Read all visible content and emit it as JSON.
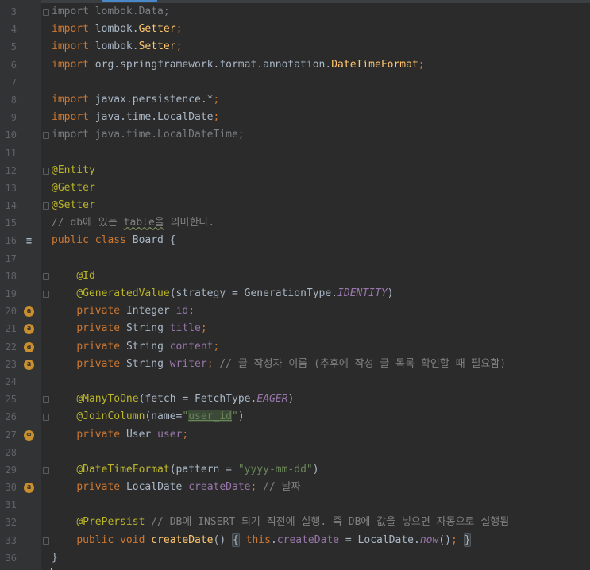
{
  "editor": {
    "lines": [
      {
        "n": "3",
        "t": [
          {
            "c": "dim",
            "s": "import lombok.Data;"
          }
        ],
        "fold": true
      },
      {
        "n": "4",
        "t": [
          {
            "c": "kw",
            "s": "import "
          },
          {
            "c": "",
            "s": "lombok."
          },
          {
            "c": "fn",
            "s": "Getter"
          },
          {
            "c": "kw",
            "s": ";"
          }
        ]
      },
      {
        "n": "5",
        "t": [
          {
            "c": "kw",
            "s": "import "
          },
          {
            "c": "",
            "s": "lombok."
          },
          {
            "c": "fn",
            "s": "Setter"
          },
          {
            "c": "kw",
            "s": ";"
          }
        ]
      },
      {
        "n": "6",
        "t": [
          {
            "c": "kw",
            "s": "import "
          },
          {
            "c": "",
            "s": "org.springframework.format.annotation."
          },
          {
            "c": "fn",
            "s": "DateTimeFormat"
          },
          {
            "c": "kw",
            "s": ";"
          }
        ]
      },
      {
        "n": "7",
        "t": []
      },
      {
        "n": "8",
        "t": [
          {
            "c": "kw",
            "s": "import "
          },
          {
            "c": "",
            "s": "javax.persistence.*"
          },
          {
            "c": "kw",
            "s": ";"
          }
        ]
      },
      {
        "n": "9",
        "t": [
          {
            "c": "kw",
            "s": "import "
          },
          {
            "c": "",
            "s": "java.time.LocalDate"
          },
          {
            "c": "kw",
            "s": ";"
          }
        ]
      },
      {
        "n": "10",
        "t": [
          {
            "c": "dim",
            "s": "import java.time.LocalDateTime;"
          }
        ],
        "fold": true
      },
      {
        "n": "11",
        "t": []
      },
      {
        "n": "12",
        "t": [
          {
            "c": "ann",
            "s": "@Entity"
          }
        ],
        "fold": true
      },
      {
        "n": "13",
        "t": [
          {
            "c": "ann",
            "s": "@Getter"
          }
        ]
      },
      {
        "n": "14",
        "t": [
          {
            "c": "ann",
            "s": "@Setter"
          }
        ],
        "fold": true
      },
      {
        "n": "15",
        "t": [
          {
            "c": "cmt",
            "s": "// db에 있는 "
          },
          {
            "c": "cmt sq",
            "s": "table을"
          },
          {
            "c": "cmt",
            "s": " 의미한다."
          }
        ]
      },
      {
        "n": "16",
        "t": [
          {
            "c": "kw",
            "s": "public class "
          },
          {
            "c": "",
            "s": "Board {"
          }
        ],
        "icon": "≡",
        "iconClass": "db"
      },
      {
        "n": "17",
        "t": []
      },
      {
        "n": "18",
        "t": [
          {
            "c": "",
            "s": "    "
          },
          {
            "c": "ann",
            "s": "@Id"
          }
        ],
        "fold": true
      },
      {
        "n": "19",
        "t": [
          {
            "c": "",
            "s": "    "
          },
          {
            "c": "ann",
            "s": "@GeneratedValue"
          },
          {
            "c": "",
            "s": "(strategy = GenerationType."
          },
          {
            "c": "fldi",
            "s": "IDENTITY"
          },
          {
            "c": "",
            "s": ")"
          }
        ],
        "fold": true
      },
      {
        "n": "20",
        "t": [
          {
            "c": "",
            "s": "    "
          },
          {
            "c": "kw",
            "s": "private "
          },
          {
            "c": "",
            "s": "Integer "
          },
          {
            "c": "fld",
            "s": "id"
          },
          {
            "c": "kw",
            "s": ";"
          }
        ],
        "icon": "a"
      },
      {
        "n": "21",
        "t": [
          {
            "c": "",
            "s": "    "
          },
          {
            "c": "kw",
            "s": "private "
          },
          {
            "c": "",
            "s": "String "
          },
          {
            "c": "fld",
            "s": "title"
          },
          {
            "c": "kw",
            "s": ";"
          }
        ],
        "icon": "a"
      },
      {
        "n": "22",
        "t": [
          {
            "c": "",
            "s": "    "
          },
          {
            "c": "kw",
            "s": "private "
          },
          {
            "c": "",
            "s": "String "
          },
          {
            "c": "fld",
            "s": "content"
          },
          {
            "c": "kw",
            "s": ";"
          }
        ],
        "icon": "a"
      },
      {
        "n": "23",
        "t": [
          {
            "c": "",
            "s": "    "
          },
          {
            "c": "kw",
            "s": "private "
          },
          {
            "c": "",
            "s": "String "
          },
          {
            "c": "fld",
            "s": "writer"
          },
          {
            "c": "kw",
            "s": "; "
          },
          {
            "c": "cmt",
            "s": "// 글 작성자 이름 (추후에 작성 글 목록 확인할 때 필요함)"
          }
        ],
        "icon": "a"
      },
      {
        "n": "24",
        "t": []
      },
      {
        "n": "25",
        "t": [
          {
            "c": "",
            "s": "    "
          },
          {
            "c": "ann",
            "s": "@ManyToOne"
          },
          {
            "c": "",
            "s": "(fetch = FetchType."
          },
          {
            "c": "fldi",
            "s": "EAGER"
          },
          {
            "c": "",
            "s": ")"
          }
        ],
        "fold": true
      },
      {
        "n": "26",
        "t": [
          {
            "c": "",
            "s": "    "
          },
          {
            "c": "ann",
            "s": "@JoinColumn"
          },
          {
            "c": "",
            "s": "(name="
          },
          {
            "c": "str",
            "s": "\""
          },
          {
            "c": "str strhl",
            "s": "user_id"
          },
          {
            "c": "str",
            "s": "\""
          },
          {
            "c": "",
            "s": ")"
          }
        ],
        "fold": true
      },
      {
        "n": "27",
        "t": [
          {
            "c": "",
            "s": "    "
          },
          {
            "c": "kw",
            "s": "private "
          },
          {
            "c": "",
            "s": "User "
          },
          {
            "c": "fld",
            "s": "user"
          },
          {
            "c": "kw",
            "s": ";"
          }
        ],
        "icon": "∞"
      },
      {
        "n": "28",
        "t": []
      },
      {
        "n": "29",
        "t": [
          {
            "c": "",
            "s": "    "
          },
          {
            "c": "ann",
            "s": "@DateTimeFormat"
          },
          {
            "c": "",
            "s": "(pattern = "
          },
          {
            "c": "str",
            "s": "\"yyyy-mm-dd\""
          },
          {
            "c": "",
            "s": ")"
          }
        ],
        "fold": true
      },
      {
        "n": "30",
        "t": [
          {
            "c": "",
            "s": "    "
          },
          {
            "c": "kw",
            "s": "private "
          },
          {
            "c": "",
            "s": "LocalDate "
          },
          {
            "c": "fld",
            "s": "createDate"
          },
          {
            "c": "kw",
            "s": "; "
          },
          {
            "c": "cmt",
            "s": "// 날짜"
          }
        ],
        "icon": "a"
      },
      {
        "n": "31",
        "t": []
      },
      {
        "n": "32",
        "t": [
          {
            "c": "",
            "s": "    "
          },
          {
            "c": "ann",
            "s": "@PrePersist "
          },
          {
            "c": "cmt",
            "s": "// DB에 INSERT 되기 직전에 실행. 즉 DB에 값을 넣으면 자동으로 실행됨"
          }
        ]
      },
      {
        "n": "33",
        "t": [
          {
            "c": "",
            "s": "    "
          },
          {
            "c": "kw",
            "s": "public void "
          },
          {
            "c": "fn",
            "s": "createDate"
          },
          {
            "c": "",
            "s": "() "
          },
          {
            "c": "brace",
            "s": "{"
          },
          {
            "c": "",
            "s": " "
          },
          {
            "c": "kw",
            "s": "this"
          },
          {
            "c": "",
            "s": "."
          },
          {
            "c": "fld",
            "s": "createDate "
          },
          {
            "c": "",
            "s": "= LocalDate."
          },
          {
            "c": "fldi",
            "s": "now"
          },
          {
            "c": "",
            "s": "()"
          },
          {
            "c": "kw",
            "s": "; "
          },
          {
            "c": "brace",
            "s": "}"
          }
        ],
        "fold": true
      },
      {
        "n": "36",
        "t": [
          {
            "c": "",
            "s": "}"
          }
        ]
      }
    ]
  }
}
